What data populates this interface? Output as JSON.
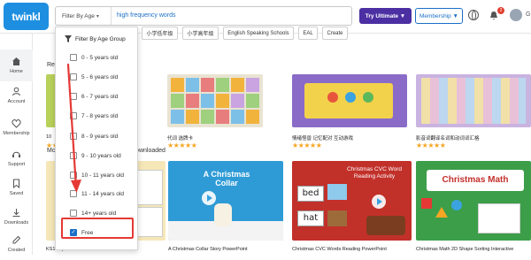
{
  "brand": {
    "logo": "twinkl",
    "color": "#1e8fe0"
  },
  "search": {
    "filter_label": "Filter By Age",
    "query": "high frequency words"
  },
  "header": {
    "try_label": "Try Ultimate ▼",
    "membership_label": "Membership ▼",
    "notif_count": "2"
  },
  "sidebar": {
    "items": [
      {
        "label": "Home",
        "icon": "home-icon"
      },
      {
        "label": "Account",
        "icon": "account-icon"
      },
      {
        "label": "Membership",
        "icon": "membership-icon"
      },
      {
        "label": "Support",
        "icon": "support-icon"
      },
      {
        "label": "Saved",
        "icon": "saved-icon"
      },
      {
        "label": "Downloads",
        "icon": "downloads-icon"
      },
      {
        "label": "Created",
        "icon": "created-icon"
      }
    ]
  },
  "chips": [
    "小学低年级",
    "小学高年级",
    "English Speaking Schools",
    "EAL",
    "Create"
  ],
  "sections": {
    "recent_prefix": "Re",
    "most_prefix": "Mo",
    "downloaded_suffix": "Downloaded"
  },
  "filter_dropdown": {
    "heading": "Filter By Age Group",
    "options": [
      {
        "label": "0 - 5 years old",
        "checked": false
      },
      {
        "label": "5 - 6 years old",
        "checked": false
      },
      {
        "label": "6 - 7 years old",
        "checked": false
      },
      {
        "label": "7 - 8 years old",
        "checked": false
      },
      {
        "label": "8 - 9 years old",
        "checked": false
      },
      {
        "label": "9 - 10 years old",
        "checked": false
      },
      {
        "label": "10 - 11 years old",
        "checked": false
      },
      {
        "label": "11 - 14 years old",
        "checked": false
      },
      {
        "label": "14+ years old",
        "checked": false
      },
      {
        "label": "Free",
        "checked": true
      }
    ]
  },
  "row1": [
    {
      "label": "10",
      "color": "#b8d15a"
    },
    {
      "label": "代词 选牌卡",
      "color": "#e9e3d2"
    },
    {
      "label": "情绪怪兽 记忆配对 互动游戏",
      "color": "#8a6cc8"
    },
    {
      "label": "影音词翻译名词和动词词汇格",
      "color": "#c9b3e0"
    }
  ],
  "row2": [
    {
      "label": "KS1 Top 10 Christmas Maths Worksheets",
      "color": "#f6e7b8"
    },
    {
      "label": "A Christmas Collar Story PowerPoint",
      "color": "#2f9bd6",
      "text": "A Christmas Collar"
    },
    {
      "label": "Christmas CVC Words Reading PowerPoint",
      "color": "#c2302a",
      "text": "Christmas CVC Word Reading Activity"
    },
    {
      "label": "Christmas Math 2D Shape Sorting Interactive",
      "color": "#3c9e49",
      "text": "Christmas Math"
    }
  ],
  "cvc_words": [
    "bed",
    "hat"
  ],
  "star_rating": "★★★★★"
}
